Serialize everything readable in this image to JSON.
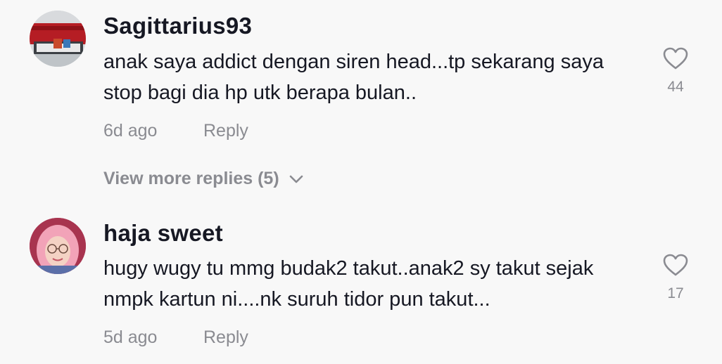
{
  "comments": [
    {
      "username": "Sagittarius93",
      "text": "anak saya addict dengan siren head...tp sekarang saya stop bagi dia hp utk berapa bulan..",
      "time": "6d ago",
      "reply_label": "Reply",
      "likes": "44"
    },
    {
      "username": "haja sweet",
      "text": "hugy wugy tu mmg budak2 takut..anak2 sy takut sejak nmpk kartun ni....nk suruh tidor pun takut...",
      "time": "5d ago",
      "reply_label": "Reply",
      "likes": "17"
    }
  ],
  "view_more_replies": "View more replies (5)",
  "icons": {
    "like": "heart-outline-icon",
    "expand": "chevron-down-icon"
  },
  "colors": {
    "background": "#f8f8f8",
    "primary_text": "#161823",
    "secondary_text": "#8a8b91"
  }
}
